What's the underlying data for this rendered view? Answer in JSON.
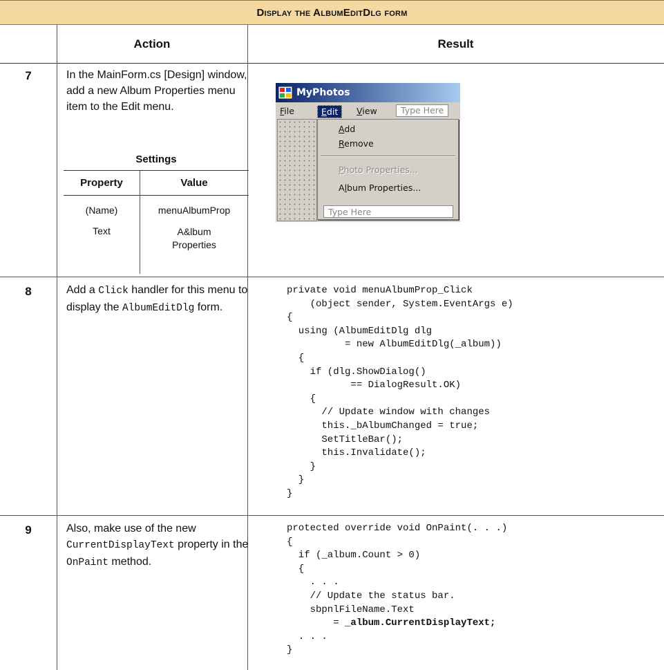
{
  "title": "Display the AlbumEditDlg form",
  "columns": {
    "action": "Action",
    "result": "Result"
  },
  "steps": [
    {
      "number": "7",
      "action_text": "In the MainForm.cs [Design] window, add a new Album Properties menu item to the Edit menu.",
      "settings": {
        "title": "Settings",
        "headers": [
          "Property",
          "Value"
        ],
        "rows": [
          {
            "property": "(Name)",
            "value": "menuAlbumProp"
          },
          {
            "property": "Text",
            "value": "A&lbum Properties"
          }
        ]
      },
      "screenshot": {
        "window_title": "MyPhotos",
        "menubar": [
          "File",
          "Edit",
          "View"
        ],
        "menubar_type_here": "Type Here",
        "menu_items": [
          "Add",
          "Remove",
          "Photo Properties...",
          "Album Properties..."
        ],
        "menu_type_here": "Type Here",
        "colors": {
          "title_start": "#0a246a",
          "title_end": "#a6caf0",
          "face": "#d4d0c8"
        }
      }
    },
    {
      "number": "8",
      "action_parts": [
        "Add a ",
        "Click",
        " handler for this menu to display the ",
        "AlbumEditDlg",
        " form."
      ],
      "code": [
        "private void menuAlbumProp_Click",
        "    (object sender, System.EventArgs e)",
        "{",
        "  using (AlbumEditDlg dlg",
        "          = new AlbumEditDlg(_album))",
        "  {",
        "    if (dlg.ShowDialog()",
        "           == DialogResult.OK)",
        "    {",
        "      // Update window with changes",
        "      this._bAlbumChanged = true;",
        "      SetTitleBar();",
        "      this.Invalidate();",
        "    }",
        "  }",
        "}"
      ]
    },
    {
      "number": "9",
      "action_parts": [
        "Also, make use of the new ",
        "CurrentDisplayText",
        " property in the ",
        "OnPaint",
        " method."
      ],
      "code": [
        "protected override void OnPaint(. . .)",
        "{",
        "  if (_album.Count > 0)",
        "  {",
        "    . . .",
        "    // Update the status bar.",
        "    sbpnlFileName.Text",
        "        = ",
        "  . . .",
        "}"
      ],
      "code_bold": "_album.CurrentDisplayText;"
    }
  ]
}
